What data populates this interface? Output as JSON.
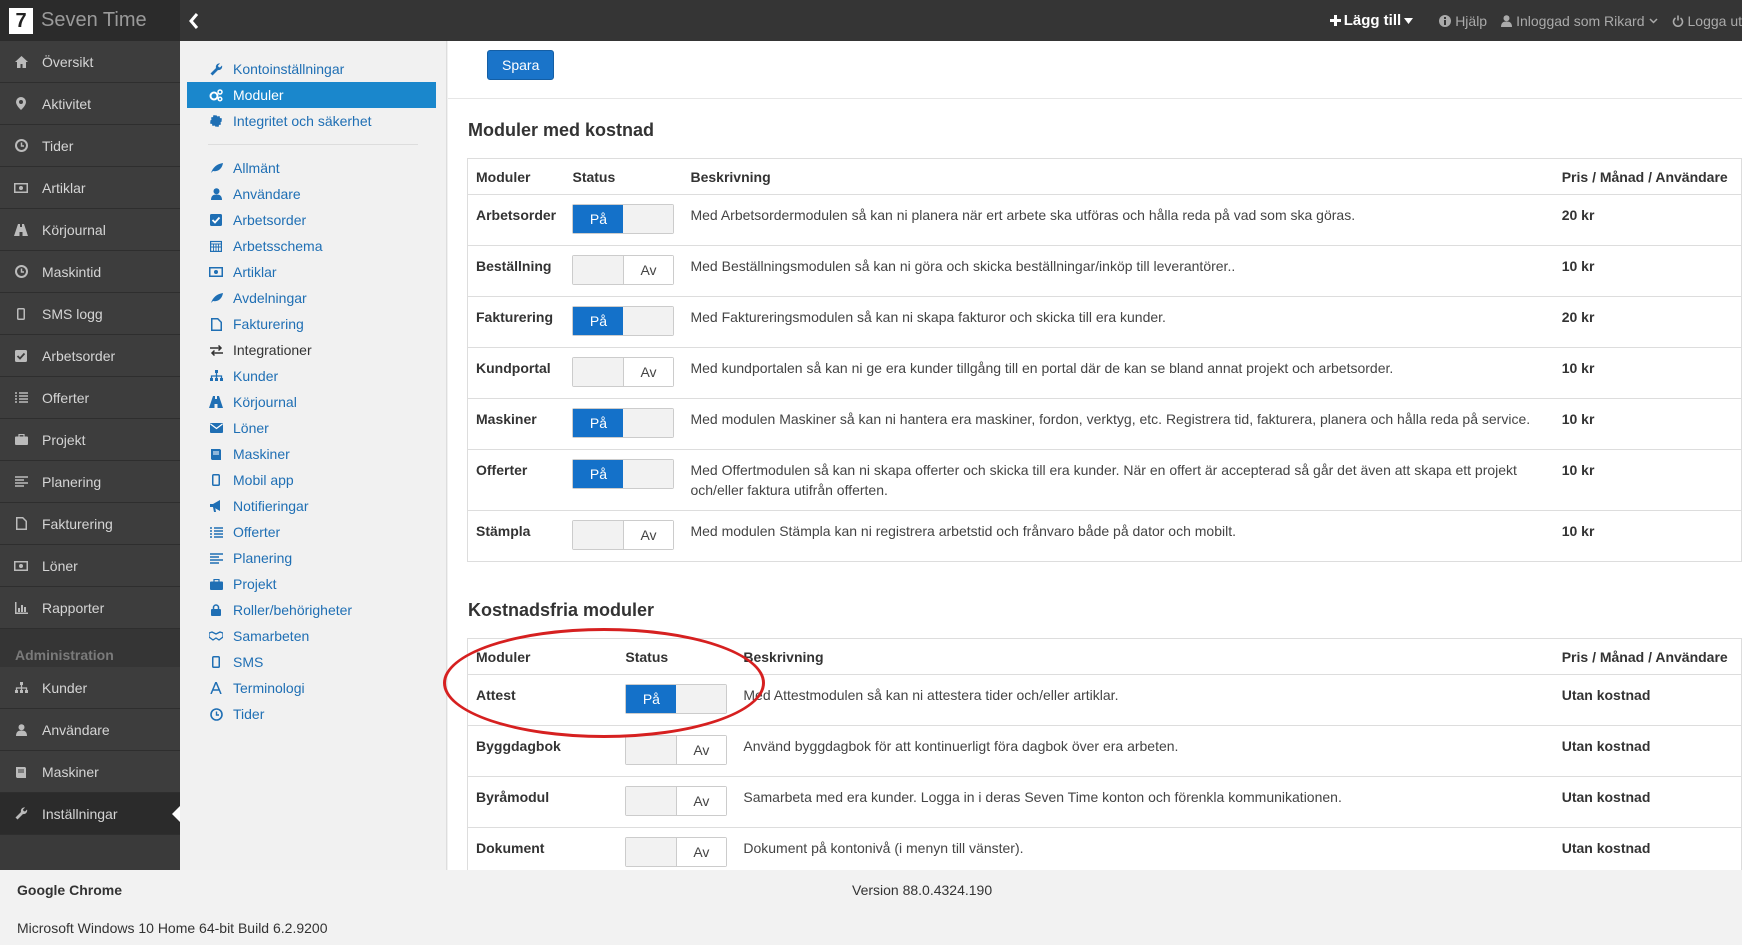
{
  "app": {
    "logo": "7",
    "name": "Seven Time"
  },
  "topnav": {
    "add": "Lägg till",
    "help": "Hjälp",
    "user": "Inloggad som Rikard",
    "logout": "Logga ut"
  },
  "sidebar": {
    "items": [
      {
        "label": "Översikt",
        "icon": "home-icon"
      },
      {
        "label": "Aktivitet",
        "icon": "map-marker-icon"
      },
      {
        "label": "Tider",
        "icon": "clock-icon"
      },
      {
        "label": "Artiklar",
        "icon": "money-icon"
      },
      {
        "label": "Körjournal",
        "icon": "road-icon"
      },
      {
        "label": "Maskintid",
        "icon": "clock-icon"
      },
      {
        "label": "SMS logg",
        "icon": "mobile-icon"
      },
      {
        "label": "Arbetsorder",
        "icon": "check-square-icon"
      },
      {
        "label": "Offerter",
        "icon": "list-icon"
      },
      {
        "label": "Projekt",
        "icon": "briefcase-icon"
      },
      {
        "label": "Planering",
        "icon": "align-left-icon"
      },
      {
        "label": "Fakturering",
        "icon": "file-icon"
      },
      {
        "label": "Löner",
        "icon": "money-icon"
      },
      {
        "label": "Rapporter",
        "icon": "bar-chart-icon"
      }
    ],
    "admin_header": "Administration",
    "admin_items": [
      {
        "label": "Kunder",
        "icon": "sitemap-icon"
      },
      {
        "label": "Användare",
        "icon": "user-icon"
      },
      {
        "label": "Maskiner",
        "icon": "book-icon"
      },
      {
        "label": "Inställningar",
        "icon": "wrench-icon"
      }
    ]
  },
  "settings_menu": {
    "top": [
      {
        "label": "Kontoinställningar",
        "icon": "wrench-icon"
      },
      {
        "label": "Moduler",
        "icon": "cogs-icon"
      },
      {
        "label": "Integritet och säkerhet",
        "icon": "certificate-icon"
      }
    ],
    "items": [
      {
        "label": "Allmänt",
        "icon": "leaf-icon"
      },
      {
        "label": "Användare",
        "icon": "user-icon"
      },
      {
        "label": "Arbetsorder",
        "icon": "check-square-icon"
      },
      {
        "label": "Arbetsschema",
        "icon": "calendar-icon"
      },
      {
        "label": "Artiklar",
        "icon": "money-icon"
      },
      {
        "label": "Avdelningar",
        "icon": "leaf-icon"
      },
      {
        "label": "Fakturering",
        "icon": "file-icon"
      },
      {
        "label": "Integrationer",
        "icon": "exchange-icon"
      },
      {
        "label": "Kunder",
        "icon": "sitemap-icon"
      },
      {
        "label": "Körjournal",
        "icon": "road-icon"
      },
      {
        "label": "Löner",
        "icon": "envelope-icon"
      },
      {
        "label": "Maskiner",
        "icon": "book-icon"
      },
      {
        "label": "Mobil app",
        "icon": "mobile-icon"
      },
      {
        "label": "Notifieringar",
        "icon": "bullhorn-icon"
      },
      {
        "label": "Offerter",
        "icon": "list-icon"
      },
      {
        "label": "Planering",
        "icon": "align-left-icon"
      },
      {
        "label": "Projekt",
        "icon": "briefcase-icon"
      },
      {
        "label": "Roller/behörigheter",
        "icon": "lock-icon"
      },
      {
        "label": "Samarbeten",
        "icon": "handshake-icon"
      },
      {
        "label": "SMS",
        "icon": "mobile-icon"
      },
      {
        "label": "Terminologi",
        "icon": "font-icon"
      },
      {
        "label": "Tider",
        "icon": "clock-icon"
      }
    ]
  },
  "main": {
    "save_label": "Spara",
    "paid": {
      "title": "Moduler med kostnad",
      "headers": [
        "Moduler",
        "Status",
        "Beskrivning",
        "Pris / Månad / Användare"
      ],
      "rows": [
        {
          "name": "Arbetsorder",
          "on": true,
          "desc": "Med Arbetsordermodulen så kan ni planera när ert arbete ska utföras och hålla reda på vad som ska göras.",
          "price": "20 kr"
        },
        {
          "name": "Beställning",
          "on": false,
          "desc": "Med Beställningsmodulen så kan ni göra och skicka beställningar/inköp till leverantörer..",
          "price": "10 kr"
        },
        {
          "name": "Fakturering",
          "on": true,
          "desc": "Med Faktureringsmodulen så kan ni skapa fakturor och skicka till era kunder.",
          "price": "20 kr"
        },
        {
          "name": "Kundportal",
          "on": false,
          "desc": "Med kundportalen så kan ni ge era kunder tillgång till en portal där de kan se bland annat projekt och arbetsorder.",
          "price": "10 kr"
        },
        {
          "name": "Maskiner",
          "on": true,
          "desc": "Med modulen Maskiner så kan ni hantera era maskiner, fordon, verktyg, etc. Registrera tid, fakturera, planera och hålla reda på service.",
          "price": "10 kr"
        },
        {
          "name": "Offerter",
          "on": true,
          "desc": "Med Offertmodulen så kan ni skapa offerter och skicka till era kunder. När en offert är accepterad så går det även att skapa ett projekt och/eller faktura utifrån offerten.",
          "price": "10 kr"
        },
        {
          "name": "Stämpla",
          "on": false,
          "desc": "Med modulen Stämpla kan ni registrera arbetstid och frånvaro både på dator och mobilt.",
          "price": "10 kr"
        }
      ]
    },
    "free": {
      "title": "Kostnadsfria moduler",
      "headers": [
        "Moduler",
        "Status",
        "Beskrivning",
        "Pris / Månad / Användare"
      ],
      "rows": [
        {
          "name": "Attest",
          "on": true,
          "desc": "Med Attestmodulen så kan ni attestera tider och/eller artiklar.",
          "price": "Utan kostnad"
        },
        {
          "name": "Byggdagbok",
          "on": false,
          "desc": "Använd byggdagbok för att kontinuerligt föra dagbok över era arbeten.",
          "price": "Utan kostnad"
        },
        {
          "name": "Byråmodul",
          "on": false,
          "desc": "Samarbeta med era kunder. Logga in i deras Seven Time konton och förenkla kommunikationen.",
          "price": "Utan kostnad"
        },
        {
          "name": "Dokument",
          "on": false,
          "desc": "Dokument på kontonivå (i menyn till vänster).",
          "price": "Utan kostnad"
        }
      ]
    },
    "toggle_on": "På",
    "toggle_off": "Av"
  },
  "footer": {
    "browser": "Google Chrome",
    "version": "Version 88.0.4324.190",
    "os": "Microsoft Windows 10 Home 64-bit Build 6.2.9200"
  },
  "colors": {
    "accent": "#1a87cc",
    "toggle_on": "#1471c9",
    "sidebar": "#3d3d3d",
    "topbar": "#353535",
    "highlight": "#d62020"
  }
}
